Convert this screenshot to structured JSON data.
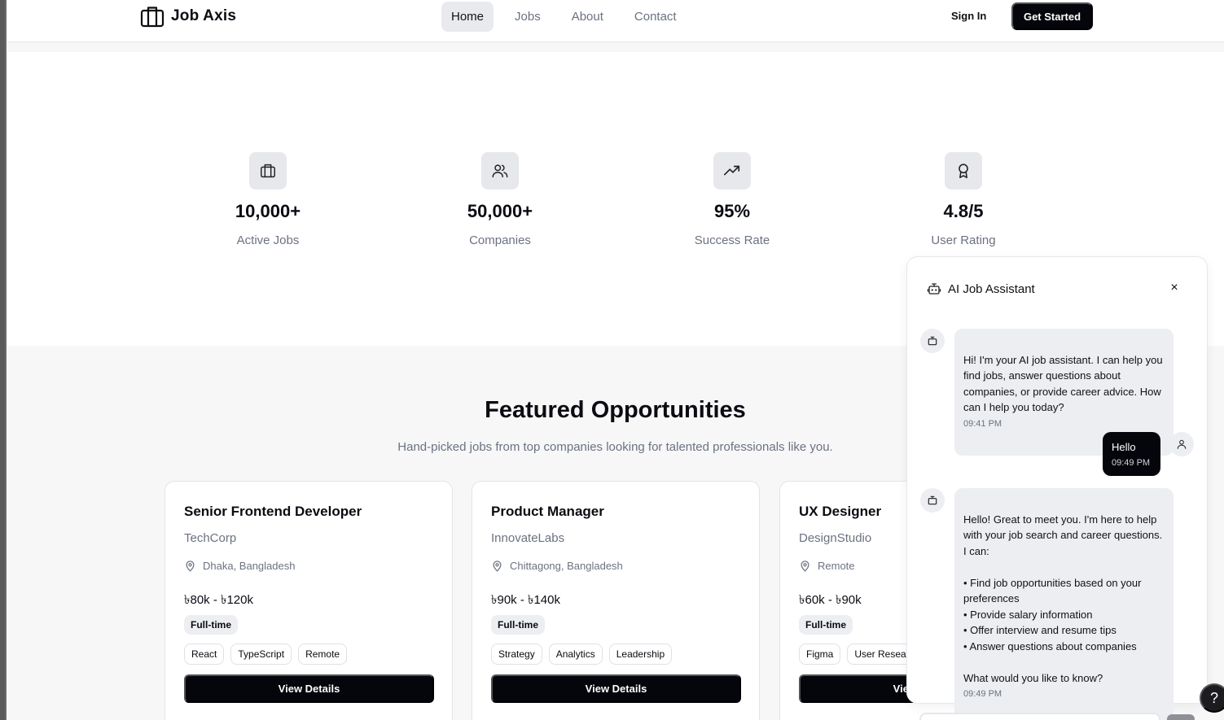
{
  "header": {
    "logo_text": "Job Axis",
    "nav": [
      "Home",
      "Jobs",
      "About",
      "Contact"
    ],
    "active_nav": "Home",
    "sign_in": "Sign In",
    "get_started": "Get Started"
  },
  "stats": [
    {
      "icon": "briefcase-icon",
      "value": "10,000+",
      "label": "Active Jobs"
    },
    {
      "icon": "users-icon",
      "value": "50,000+",
      "label": "Companies"
    },
    {
      "icon": "trending-up-icon",
      "value": "95%",
      "label": "Success Rate"
    },
    {
      "icon": "award-icon",
      "value": "4.8/5",
      "label": "User Rating"
    }
  ],
  "featured": {
    "title": "Featured Opportunities",
    "subtitle": "Hand-picked jobs from top companies looking for talented professionals like you.",
    "jobs": [
      {
        "title": "Senior Frontend Developer",
        "company": "TechCorp",
        "location": "Dhaka, Bangladesh",
        "salary": "৳80k - ৳120k",
        "type": "Full-time",
        "tags": [
          "React",
          "TypeScript",
          "Remote"
        ],
        "button": "View Details"
      },
      {
        "title": "Product Manager",
        "company": "InnovateLabs",
        "location": "Chittagong, Bangladesh",
        "salary": "৳90k - ৳140k",
        "type": "Full-time",
        "tags": [
          "Strategy",
          "Analytics",
          "Leadership"
        ],
        "button": "View Details"
      },
      {
        "title": "UX Designer",
        "company": "DesignStudio",
        "location": "Remote",
        "salary": "৳60k - ৳90k",
        "type": "Full-time",
        "tags": [
          "Figma",
          "User Research"
        ],
        "button": "View Details"
      }
    ]
  },
  "chat": {
    "title": "AI Job Assistant",
    "close": "×",
    "messages": [
      {
        "from": "bot",
        "text": "Hi! I'm your AI job assistant. I can help you find jobs, answer questions about companies, or provide career advice. How can I help you today?",
        "time": "09:41 PM"
      },
      {
        "from": "user",
        "text": "Hello",
        "time": "09:49 PM"
      },
      {
        "from": "bot",
        "text": "Hello! Great to meet you. I'm here to help with your job search and career questions. I can:\n\n• Find job opportunities based on your preferences\n• Provide salary information\n• Offer interview and resume tips\n• Answer questions about companies\n\nWhat would you like to know?",
        "time": "09:49 PM"
      }
    ]
  },
  "help": "?",
  "colors": {
    "primary": "#05050c",
    "muted": "#6b7280",
    "surface": "#f7f7f8",
    "chip": "#eceef1"
  }
}
